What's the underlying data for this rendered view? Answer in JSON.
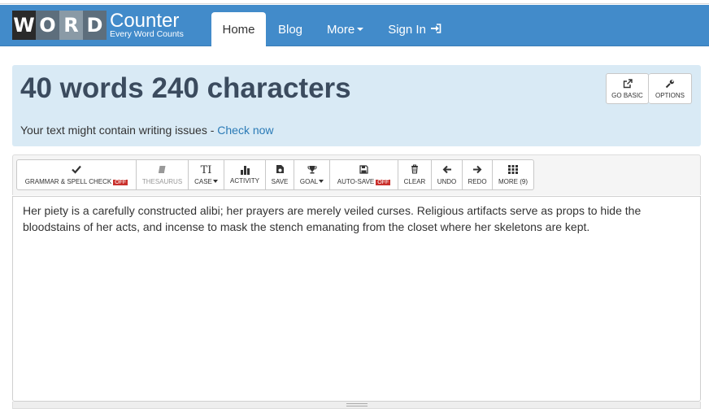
{
  "logo": {
    "letters": [
      "W",
      "O",
      "R",
      "D"
    ],
    "brand": "Counter",
    "tagline": "Every Word Counts"
  },
  "nav": {
    "home": "Home",
    "blog": "Blog",
    "more": "More",
    "signin": "Sign In"
  },
  "stats": {
    "summary": "40 words 240 characters",
    "issues_text": "Your text might contain writing issues - ",
    "issues_link": "Check now"
  },
  "top_buttons": {
    "go_basic": "GO BASIC",
    "options": "OPTIONS"
  },
  "toolbar": {
    "grammar": "GRAMMAR & SPELL CHECK",
    "grammar_state": "OFF",
    "thesaurus": "THESAURUS",
    "case": "CASE",
    "case_icon": "TI",
    "activity": "ACTIVITY",
    "save": "SAVE",
    "goal": "GOAL",
    "autosave": "AUTO-SAVE",
    "autosave_state": "OFF",
    "clear": "CLEAR",
    "undo": "UNDO",
    "redo": "REDO",
    "more": "MORE (9)"
  },
  "editor": {
    "text": "Her piety is a carefully constructed alibi; her prayers are merely veiled curses. Religious artifacts serve as props to hide the bloodstains of her acts, and incense to mask the stench emanating from the closet where her skeletons are kept."
  },
  "colors": {
    "navbar": "#428bca",
    "stats_panel": "#d9eaf5",
    "summary_text": "#3b4b5e",
    "link": "#2a7ab6",
    "off_badge": "#c9302c"
  },
  "icons": {
    "grammar": "checkmark-icon",
    "thesaurus": "book-icon",
    "case": "text-case-icon",
    "activity": "bar-chart-icon",
    "save": "save-file-icon",
    "goal": "trophy-icon",
    "autosave": "floppy-disk-icon",
    "clear": "trash-icon",
    "undo": "arrow-left-icon",
    "redo": "arrow-right-icon",
    "more": "grid-icon",
    "go_basic": "external-link-icon",
    "options": "wrench-icon",
    "signin": "sign-in-icon"
  }
}
